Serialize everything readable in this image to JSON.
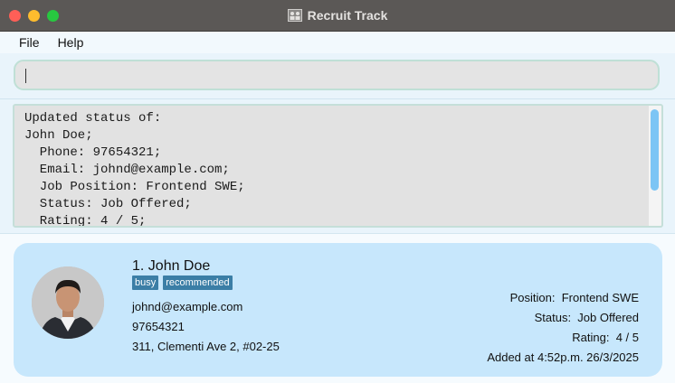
{
  "window": {
    "title": "Recruit Track"
  },
  "menu": {
    "items": [
      "File",
      "Help"
    ]
  },
  "command": {
    "value": ""
  },
  "result": {
    "text": "Updated status of:\nJohn Doe;\n  Phone: 97654321;\n  Email: johnd@example.com;\n  Job Position: Frontend SWE;\n  Status: Job Offered;\n  Rating: 4 / 5;"
  },
  "person": {
    "index_name": "1. John Doe",
    "tags": [
      "busy",
      "recommended"
    ],
    "email": "johnd@example.com",
    "phone": "97654321",
    "address": "311, Clementi Ave 2, #02-25",
    "position_label": "Position:",
    "position_value": "Frontend SWE",
    "status_label": "Status:",
    "status_value": "Job Offered",
    "rating_label": "Rating:",
    "rating_value": "4 / 5",
    "added": "Added at 4:52p.m. 26/3/2025"
  },
  "colors": {
    "card": "#c7e7fc",
    "tag": "#3b7ea6",
    "scroll_thumb": "#7cc5f5",
    "titlebar": "#5b5856"
  },
  "icons": [
    "app-icon",
    "avatar-photo"
  ]
}
